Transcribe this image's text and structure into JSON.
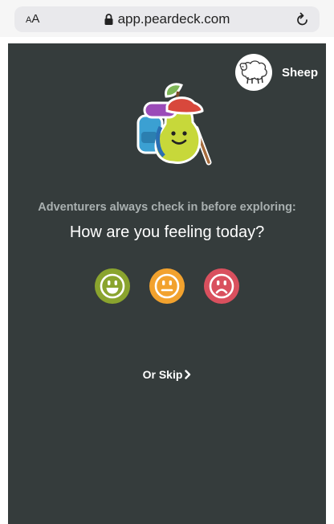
{
  "browser": {
    "text_size_label_small": "A",
    "text_size_label_large": "A",
    "url": "app.peardeck.com"
  },
  "user": {
    "name": "Sheep",
    "avatar_icon": "sheep-icon"
  },
  "checkin": {
    "subtitle": "Adventurers always check in before exploring:",
    "question": "How are you feeling today?",
    "moods": [
      {
        "name": "happy",
        "color": "#8aa42e",
        "icon": "happy-face-icon"
      },
      {
        "name": "neutral",
        "color": "#f2a22e",
        "icon": "neutral-face-icon"
      },
      {
        "name": "sad",
        "color": "#d9505e",
        "icon": "sad-face-icon"
      }
    ],
    "skip_label": "Or Skip"
  },
  "colors": {
    "background": "#353c3c",
    "text_primary": "#ffffff",
    "text_muted": "#a9b0b0"
  }
}
